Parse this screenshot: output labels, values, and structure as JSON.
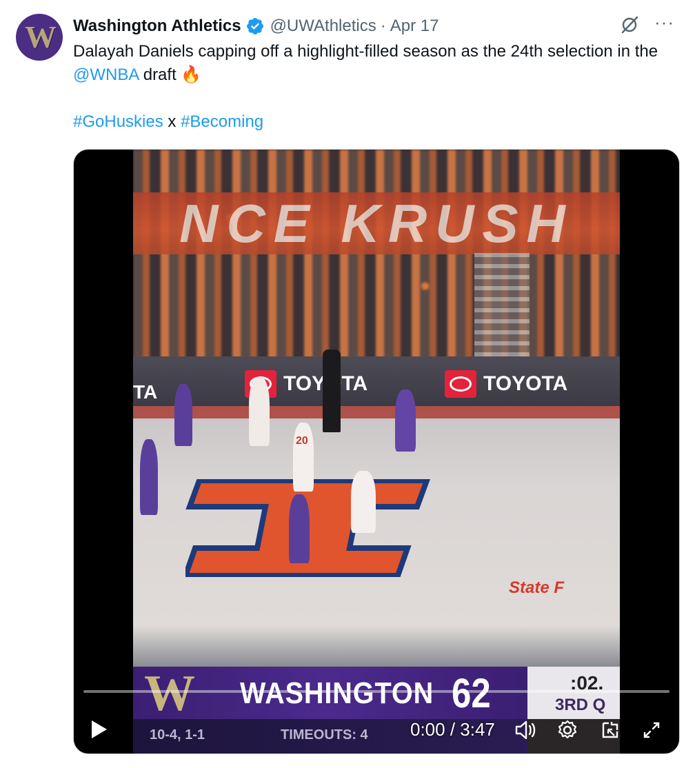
{
  "author": {
    "name": "Washington Athletics",
    "handle": "@UWAthletics",
    "separator": "·",
    "date": "Apr 17",
    "avatar_letter": "W"
  },
  "tweet": {
    "text_before_mention": "Dalayah Daniels capping off a highlight-filled season as the 24th selection in the ",
    "mention": "@WNBA",
    "text_after_mention": " draft 🔥",
    "hashtag_1": "#GoHuskies",
    "hashtag_joiner": " x ",
    "hashtag_2": "#Becoming"
  },
  "header_icons": {
    "grok": "grok-icon",
    "more": "···"
  },
  "video": {
    "scene": {
      "banner_text": "NCE KRUSH",
      "sponsor_left": "TOYOTA",
      "sponsor_right": "TOYOTA",
      "sponsor_partial": "TA",
      "court_ad": "State F",
      "jersey_number": "20"
    },
    "scoreboard": {
      "logo_letter": "W",
      "team": "WASHINGTON",
      "score": "62",
      "record": "10-4, 1-1",
      "timeouts": "TIMEOUTS: 4",
      "clock": ":02.",
      "quarter": "3RD Q"
    },
    "player": {
      "current_time": "0:00",
      "time_separator": " / ",
      "duration": "3:47",
      "progress_fraction": 0.0
    }
  },
  "colors": {
    "link": "#1d9bf0",
    "verified": "#1d9bf0",
    "uw_purple": "#4b2e83",
    "uw_gold": "#b7a57a"
  }
}
